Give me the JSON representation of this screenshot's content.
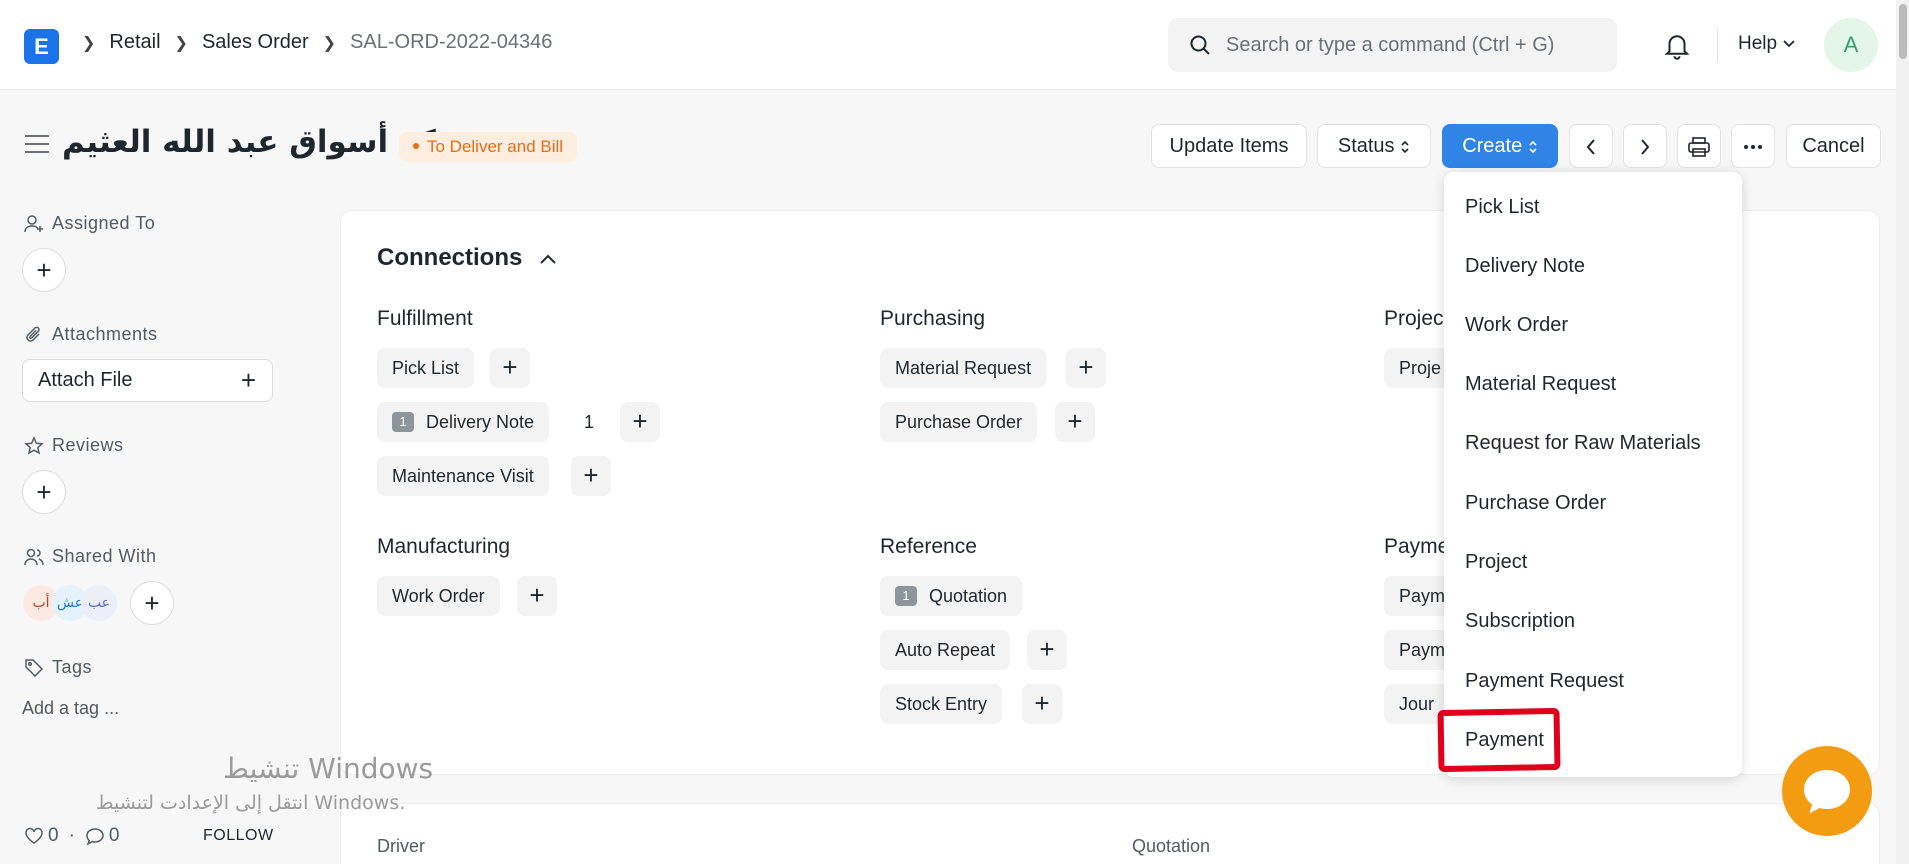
{
  "breadcrumbs": [
    "Retail",
    "Sales Order",
    "SAL-ORD-2022-04346"
  ],
  "logo_letter": "E",
  "search": {
    "placeholder": "Search or type a command (Ctrl + G)"
  },
  "help_label": "Help",
  "avatar_letter": "A",
  "page_title": "شركة أسواق عبد الله العثيم",
  "status_badge": "To Deliver and Bill",
  "toolbar": {
    "update_items": "Update Items",
    "status": "Status",
    "create": "Create",
    "cancel": "Cancel"
  },
  "sidebar": {
    "assigned_to": "Assigned To",
    "attachments": "Attachments",
    "attach_file": "Attach File",
    "reviews": "Reviews",
    "shared_with": "Shared With",
    "shared_avatars": [
      "أب",
      "عش",
      "عب"
    ],
    "tags": "Tags",
    "add_tag": "Add a tag ...",
    "likes": "0",
    "comments": "0",
    "follow": "FOLLOW"
  },
  "connections": {
    "title": "Connections",
    "groups": {
      "fulfillment": {
        "title": "Fulfillment",
        "items": [
          "Pick List",
          "Delivery Note",
          "Maintenance Visit"
        ],
        "delivery_count": "1",
        "delivery_badge": "1"
      },
      "purchasing": {
        "title": "Purchasing",
        "items": [
          "Material Request",
          "Purchase Order"
        ]
      },
      "projects": {
        "title": "Projec",
        "items": [
          "Proje"
        ]
      },
      "manufacturing": {
        "title": "Manufacturing",
        "items": [
          "Work Order"
        ]
      },
      "reference": {
        "title": "Reference",
        "items": [
          "Quotation",
          "Auto Repeat",
          "Stock Entry"
        ],
        "quotation_badge": "1"
      },
      "payments": {
        "title": "Payme",
        "items": [
          "Paym",
          "Paym",
          "Jour"
        ]
      }
    }
  },
  "create_menu": [
    "Pick List",
    "Delivery Note",
    "Work Order",
    "Material Request",
    "Request for Raw Materials",
    "Purchase Order",
    "Project",
    "Subscription",
    "Payment Request",
    "Payment"
  ],
  "bottom_fields": [
    "Driver",
    "Quotation"
  ],
  "watermark": {
    "line1": "تنشيط Windows",
    "line2": "انتقل إلى الإعدادت لتنشيط Windows."
  },
  "colors": {
    "primary": "#2f84e6",
    "status": "#e86c13",
    "highlight": "#e0001b",
    "chat": "#f39c12"
  }
}
